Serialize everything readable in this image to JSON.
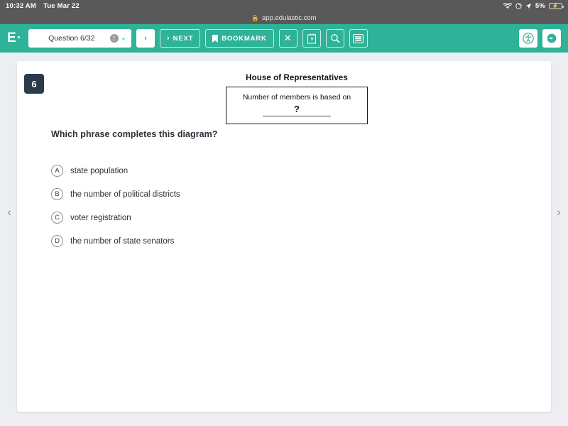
{
  "status_bar": {
    "time": "10:32 AM",
    "date": "Tue Mar 22",
    "battery_percent": "5%",
    "icons": [
      "wifi-icon",
      "orientation-lock-icon",
      "location-arrow-icon",
      "battery-charging-icon"
    ]
  },
  "browser": {
    "url": "app.edulastic.com",
    "lock_icon": "lock-icon"
  },
  "toolbar": {
    "logo": "E·",
    "question_selector": "Question 6/32",
    "info_icon": "!",
    "prev_label": "‹",
    "next_label": "NEXT",
    "next_arrow": "›",
    "bookmark_label": "BOOKMARK",
    "close_label": "✕",
    "notepad_icon": "notepad-icon",
    "search_icon": "search-icon",
    "menu_icon": "menu-icon",
    "accessibility_icon": "accessibility-icon",
    "exit_icon": "exit-icon",
    "accent_color": "#2eb398"
  },
  "question": {
    "number": "6",
    "prompt": "Which phrase completes this diagram?",
    "diagram": {
      "title": "House of Representatives",
      "body_text": "Number of members is based on",
      "blank_marker": "?"
    },
    "choices": [
      {
        "letter": "A",
        "text": "state population"
      },
      {
        "letter": "B",
        "text": "the number of political districts"
      },
      {
        "letter": "C",
        "text": "voter registration"
      },
      {
        "letter": "D",
        "text": "the number of state senators"
      }
    ]
  },
  "page_nav": {
    "prev": "‹",
    "next": "›"
  }
}
